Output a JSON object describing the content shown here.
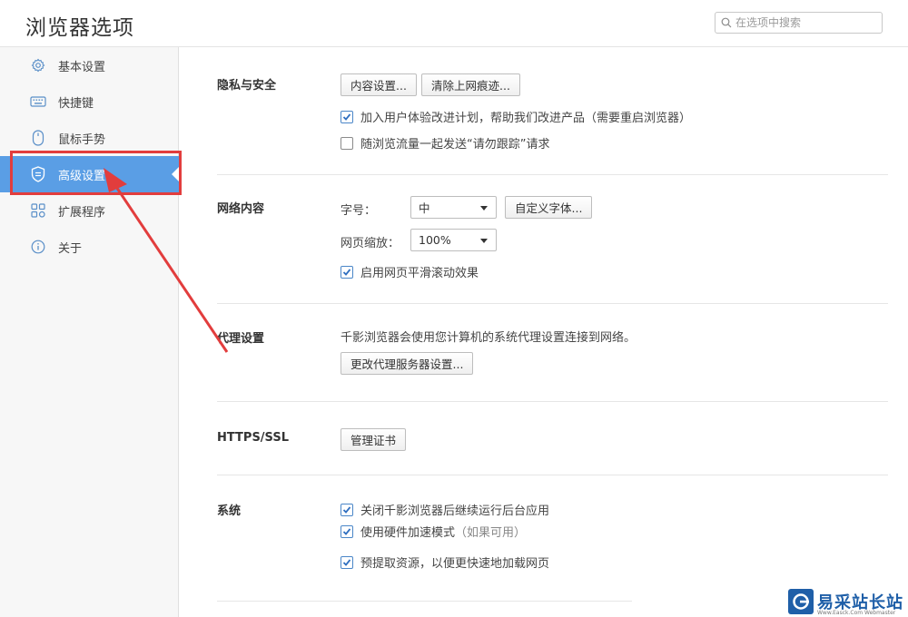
{
  "header": {
    "title": "浏览器选项",
    "search_placeholder": "在选项中搜索"
  },
  "sidebar": {
    "items": [
      {
        "label": "基本设置",
        "icon": "gear-icon"
      },
      {
        "label": "快捷键",
        "icon": "keyboard-icon"
      },
      {
        "label": "鼠标手势",
        "icon": "mouse-icon"
      },
      {
        "label": "高级设置",
        "icon": "shield-icon",
        "active": true
      },
      {
        "label": "扩展程序",
        "icon": "puzzle-grid-icon"
      },
      {
        "label": "关于",
        "icon": "info-icon"
      }
    ]
  },
  "privacy": {
    "title": "隐私与安全",
    "content_settings_btn": "内容设置...",
    "clear_traces_btn": "清除上网痕迹...",
    "ux_plan_label": "加入用户体验改进计划，帮助我们改进产品（需要重启浏览器）",
    "ux_plan_checked": true,
    "dnt_label": "随浏览流量一起发送“请勿跟踪”请求",
    "dnt_checked": false
  },
  "web_content": {
    "title": "网络内容",
    "font_size_label": "字号：",
    "font_size_value": "中",
    "custom_font_btn": "自定义字体...",
    "zoom_label": "网页缩放：",
    "zoom_value": "100%",
    "smooth_scroll_label": "启用网页平滑滚动效果",
    "smooth_scroll_checked": true
  },
  "proxy": {
    "title": "代理设置",
    "description": "千影浏览器会使用您计算机的系统代理设置连接到网络。",
    "change_btn": "更改代理服务器设置..."
  },
  "https": {
    "title": "HTTPS/SSL",
    "manage_certs_btn": "管理证书"
  },
  "system": {
    "title": "系统",
    "bg_apps_label": "关闭千影浏览器后继续运行后台应用",
    "bg_apps_checked": true,
    "hw_accel_label": "使用硬件加速模式",
    "hw_accel_hint": "（如果可用）",
    "hw_accel_checked": true,
    "prefetch_label": "预提取资源，以便更快速地加载网页",
    "prefetch_checked": true
  },
  "watermark": {
    "title": "易采站长站",
    "subtitle": "Www.Easck.Com Webmaster"
  },
  "colors": {
    "accent": "#5a9ee5",
    "annotation_red": "#e23d3d",
    "checkbox_blue": "#2f6fc0"
  }
}
